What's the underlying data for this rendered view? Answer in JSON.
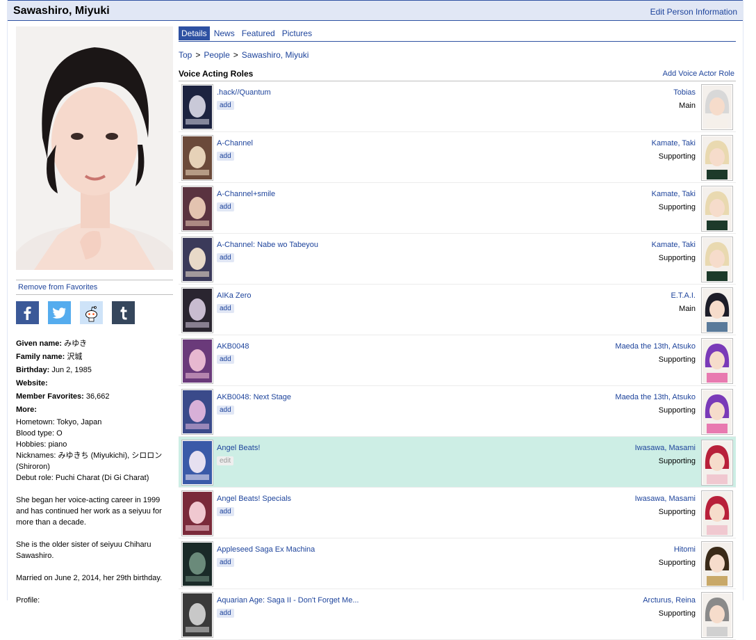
{
  "header": {
    "title": "Sawashiro, Miyuki",
    "edit_label": "Edit Person Information"
  },
  "left": {
    "remove_favorites": "Remove from Favorites",
    "given_name_label": "Given name:",
    "given_name": "みゆき",
    "family_name_label": "Family name:",
    "family_name": "沢城",
    "birthday_label": "Birthday:",
    "birthday": "Jun 2, 1985",
    "website_label": "Website:",
    "favorites_label": "Member Favorites:",
    "favorites": "36,662",
    "more_label": "More:",
    "more_lines": [
      "Hometown: Tokyo, Japan",
      "Blood type: O",
      "Hobbies: piano",
      "Nicknames: みゆきち (Miyukichi), シロロン (Shiroron)",
      "Debut role: Puchi Charat (Di Gi Charat)"
    ],
    "para1": "She began her voice-acting career in 1999 and has continued her work as a seiyuu for more than a decade.",
    "para2": "She is the older sister of seiyuu Chiharu Sawashiro.",
    "para3": "Married on June 2, 2014, her 29th birthday.",
    "profile_label": "Profile:",
    "share": [
      "facebook-icon",
      "twitter-icon",
      "reddit-icon",
      "tumblr-icon"
    ]
  },
  "tabs": [
    "Details",
    "News",
    "Featured",
    "Pictures"
  ],
  "breadcrumb": [
    "Top",
    "People",
    "Sawashiro, Miyuki"
  ],
  "section": {
    "title": "Voice Acting Roles",
    "add_label": "Add Voice Actor Role"
  },
  "roles": [
    {
      "anime": ".hack//Quantum",
      "action": "add",
      "character": "Tobias",
      "role": "Main"
    },
    {
      "anime": "A-Channel",
      "action": "add",
      "character": "Kamate, Taki",
      "role": "Supporting"
    },
    {
      "anime": "A-Channel+smile",
      "action": "add",
      "character": "Kamate, Taki",
      "role": "Supporting"
    },
    {
      "anime": "A-Channel: Nabe wo Tabeyou",
      "action": "add",
      "character": "Kamate, Taki",
      "role": "Supporting"
    },
    {
      "anime": "AIKa Zero",
      "action": "add",
      "character": "E.T.A.I.",
      "role": "Main"
    },
    {
      "anime": "AKB0048",
      "action": "add",
      "character": "Maeda the 13th, Atsuko",
      "role": "Supporting"
    },
    {
      "anime": "AKB0048: Next Stage",
      "action": "add",
      "character": "Maeda the 13th, Atsuko",
      "role": "Supporting"
    },
    {
      "anime": "Angel Beats!",
      "action": "edit",
      "character": "Iwasawa, Masami",
      "role": "Supporting",
      "highlight": true
    },
    {
      "anime": "Angel Beats! Specials",
      "action": "add",
      "character": "Iwasawa, Masami",
      "role": "Supporting"
    },
    {
      "anime": "Appleseed Saga Ex Machina",
      "action": "add",
      "character": "Hitomi",
      "role": "Supporting"
    },
    {
      "anime": "Aquarian Age: Saga II - Don't Forget Me...",
      "action": "add",
      "character": "Arcturus, Reina",
      "role": "Supporting"
    }
  ],
  "colors": {
    "link": "#1d439b",
    "header_bg": "#e1e7f5",
    "accent": "#2e51a2",
    "highlight_row": "#cdeee5"
  }
}
